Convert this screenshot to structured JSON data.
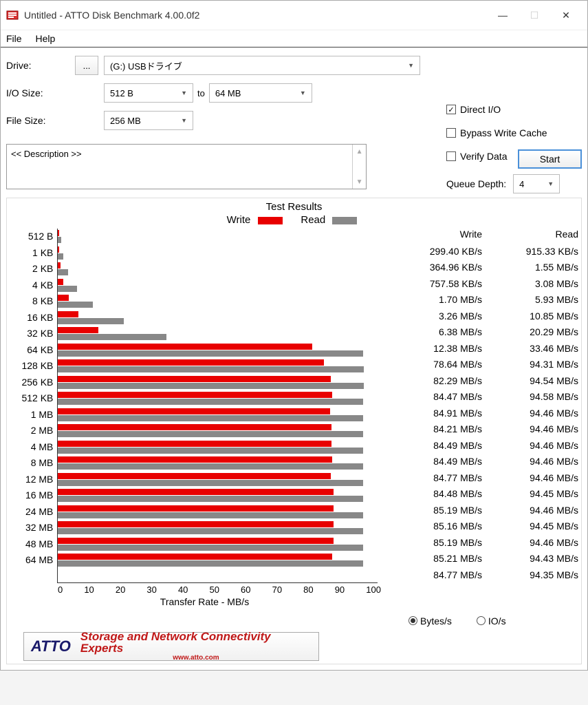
{
  "window": {
    "title": "Untitled - ATTO Disk Benchmark 4.00.0f2"
  },
  "menu": {
    "file": "File",
    "help": "Help"
  },
  "labels": {
    "drive": "Drive:",
    "io_size": "I/O Size:",
    "file_size": "File Size:",
    "to": "to",
    "direct_io": "Direct I/O",
    "bypass": "Bypass Write Cache",
    "verify": "Verify Data",
    "queue_depth": "Queue Depth:",
    "description": "<< Description >>",
    "start": "Start",
    "test_results": "Test Results",
    "write": "Write",
    "read": "Read",
    "xlabel": "Transfer Rate - MB/s",
    "bytes_s": "Bytes/s",
    "io_s": "IO/s"
  },
  "values": {
    "drive": "(G:) USBドライブ",
    "io_min": "512 B",
    "io_max": "64 MB",
    "file_size": "256 MB",
    "queue_depth": "4"
  },
  "checkboxes": {
    "direct_io": true,
    "bypass": false,
    "verify": false
  },
  "radios": {
    "bytes_s": true,
    "io_s": false
  },
  "banner": {
    "brand": "ATTO",
    "slogan": "Storage and Network Connectivity Experts",
    "url": "www.atto.com"
  },
  "chart_data": {
    "type": "bar",
    "xlabel": "Transfer Rate - MB/s",
    "xlim": [
      0,
      100
    ],
    "xticks": [
      0,
      10,
      20,
      30,
      40,
      50,
      60,
      70,
      80,
      90,
      100
    ],
    "categories": [
      "512 B",
      "1 KB",
      "2 KB",
      "4 KB",
      "8 KB",
      "16 KB",
      "32 KB",
      "64 KB",
      "128 KB",
      "256 KB",
      "512 KB",
      "1 MB",
      "2 MB",
      "4 MB",
      "8 MB",
      "12 MB",
      "16 MB",
      "24 MB",
      "32 MB",
      "48 MB",
      "64 MB"
    ],
    "series": [
      {
        "name": "Write",
        "color": "#e80000",
        "values_mb_s": [
          0.2994,
          0.36496,
          0.75758,
          1.7,
          3.26,
          6.38,
          12.38,
          78.64,
          82.29,
          84.47,
          84.91,
          84.21,
          84.49,
          84.49,
          84.77,
          84.48,
          85.19,
          85.16,
          85.19,
          85.21,
          84.77
        ],
        "display": [
          "299.40 KB/s",
          "364.96 KB/s",
          "757.58 KB/s",
          "1.70 MB/s",
          "3.26 MB/s",
          "6.38 MB/s",
          "12.38 MB/s",
          "78.64 MB/s",
          "82.29 MB/s",
          "84.47 MB/s",
          "84.91 MB/s",
          "84.21 MB/s",
          "84.49 MB/s",
          "84.49 MB/s",
          "84.77 MB/s",
          "84.48 MB/s",
          "85.19 MB/s",
          "85.16 MB/s",
          "85.19 MB/s",
          "85.21 MB/s",
          "84.77 MB/s"
        ]
      },
      {
        "name": "Read",
        "color": "#888888",
        "values_mb_s": [
          0.91533,
          1.55,
          3.08,
          5.93,
          10.85,
          20.29,
          33.46,
          94.31,
          94.54,
          94.58,
          94.46,
          94.46,
          94.46,
          94.46,
          94.46,
          94.45,
          94.46,
          94.45,
          94.46,
          94.43,
          94.35
        ],
        "display": [
          "915.33 KB/s",
          "1.55 MB/s",
          "3.08 MB/s",
          "5.93 MB/s",
          "10.85 MB/s",
          "20.29 MB/s",
          "33.46 MB/s",
          "94.31 MB/s",
          "94.54 MB/s",
          "94.58 MB/s",
          "94.46 MB/s",
          "94.46 MB/s",
          "94.46 MB/s",
          "94.46 MB/s",
          "94.46 MB/s",
          "94.45 MB/s",
          "94.46 MB/s",
          "94.45 MB/s",
          "94.46 MB/s",
          "94.43 MB/s",
          "94.35 MB/s"
        ]
      }
    ]
  }
}
